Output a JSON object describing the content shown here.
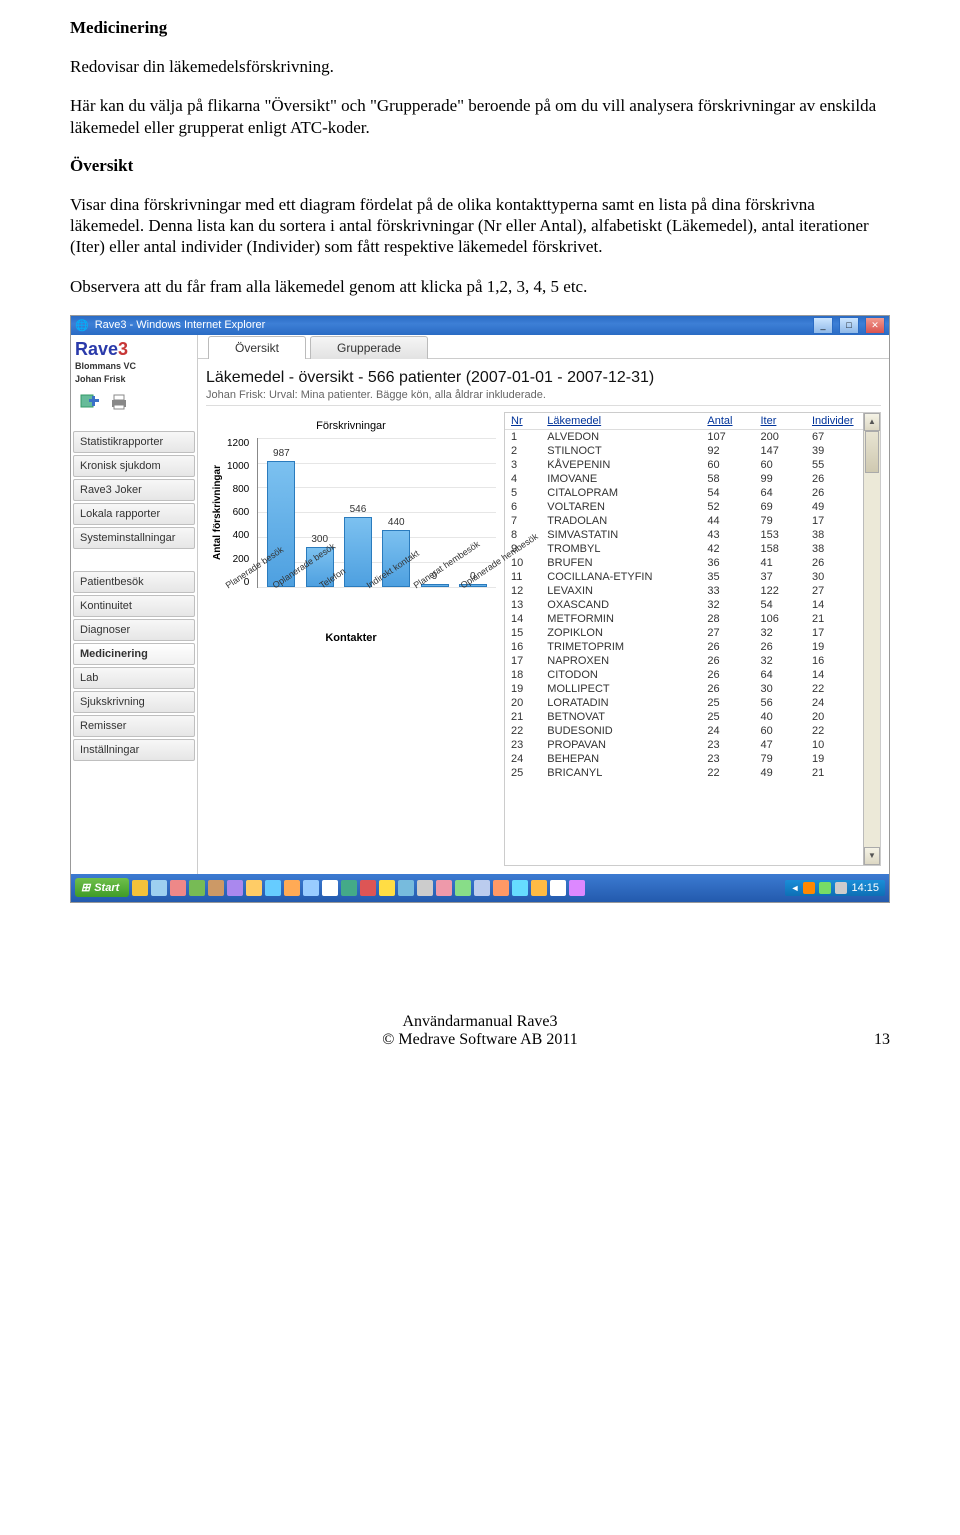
{
  "doc": {
    "h1": "Medicinering",
    "p1": "Redovisar din läkemedelsförskrivning.",
    "p2": "Här kan du välja på flikarna \"Översikt\" och \"Grupperade\" beroende på om du vill analysera förskrivningar av enskilda läkemedel eller grupperat enligt ATC-koder.",
    "h2": "Översikt",
    "p3": "Visar dina förskrivningar med ett diagram fördelat på de olika kontakttyperna samt en lista på dina förskrivna läkemedel. Denna lista kan du sortera i antal förskrivningar (Nr eller Antal), alfabetiskt (Läkemedel), antal iterationer (Iter) eller antal individer (Individer) som fått respektive läkemedel förskrivet.",
    "p4": "Observera att du får fram alla läkemedel genom att klicka på 1,2, 3, 4, 5 etc."
  },
  "window": {
    "title": "Rave3 - Windows Internet Explorer"
  },
  "logo": {
    "main": "Rave",
    "accent": "3"
  },
  "subtitle1": "Blommans VC",
  "subtitle2": "Johan Frisk",
  "menu_top": [
    "Statistikrapporter",
    "Kronisk sjukdom",
    "Rave3 Joker",
    "Lokala rapporter",
    "Systeminstallningar"
  ],
  "menu_bottom": [
    "Patientbesök",
    "Kontinuitet",
    "Diagnoser",
    "Medicinering",
    "Lab",
    "Sjukskrivning",
    "Remisser",
    "Inställningar"
  ],
  "menu_active": "Medicinering",
  "tabs": {
    "t0": "Översikt",
    "t1": "Grupperade"
  },
  "content": {
    "title": "Läkemedel - översikt - 566 patienter (2007-01-01 - 2007-12-31)",
    "subtitle": "Johan Frisk: Urval: Mina patienter. Bägge kön, alla åldrar inkluderade."
  },
  "chart_data": {
    "type": "bar",
    "title": "Förskrivningar",
    "ylabel": "Antal förskrivningar",
    "ylim": [
      0,
      1200
    ],
    "yticks": [
      "1200",
      "1000",
      "800",
      "600",
      "400",
      "200",
      "0"
    ],
    "categories": [
      "Planerade besök",
      "Oplanerade besök",
      "Telefon",
      "Indirekt kontakt",
      "Planerat hembesök",
      "Oplanerade hembesök"
    ],
    "values": [
      987,
      300,
      546,
      440,
      9,
      0
    ],
    "second_title": "Kontakter"
  },
  "table": {
    "headers": {
      "nr": "Nr",
      "name": "Läkemedel",
      "antal": "Antal",
      "iter": "Iter",
      "indiv": "Individer"
    },
    "rows": [
      {
        "nr": 1,
        "name": "ALVEDON",
        "antal": 107,
        "iter": 200,
        "indiv": 67
      },
      {
        "nr": 2,
        "name": "STILNOCT",
        "antal": 92,
        "iter": 147,
        "indiv": 39
      },
      {
        "nr": 3,
        "name": "KÅVEPENIN",
        "antal": 60,
        "iter": 60,
        "indiv": 55
      },
      {
        "nr": 4,
        "name": "IMOVANE",
        "antal": 58,
        "iter": 99,
        "indiv": 26
      },
      {
        "nr": 5,
        "name": "CITALOPRAM",
        "antal": 54,
        "iter": 64,
        "indiv": 26
      },
      {
        "nr": 6,
        "name": "VOLTAREN",
        "antal": 52,
        "iter": 69,
        "indiv": 49
      },
      {
        "nr": 7,
        "name": "TRADOLAN",
        "antal": 44,
        "iter": 79,
        "indiv": 17
      },
      {
        "nr": 8,
        "name": "SIMVASTATIN",
        "antal": 43,
        "iter": 153,
        "indiv": 38
      },
      {
        "nr": 9,
        "name": "TROMBYL",
        "antal": 42,
        "iter": 158,
        "indiv": 38
      },
      {
        "nr": 10,
        "name": "BRUFEN",
        "antal": 36,
        "iter": 41,
        "indiv": 26
      },
      {
        "nr": 11,
        "name": "COCILLANA-ETYFIN",
        "antal": 35,
        "iter": 37,
        "indiv": 30
      },
      {
        "nr": 12,
        "name": "LEVAXIN",
        "antal": 33,
        "iter": 122,
        "indiv": 27
      },
      {
        "nr": 13,
        "name": "OXASCAND",
        "antal": 32,
        "iter": 54,
        "indiv": 14
      },
      {
        "nr": 14,
        "name": "METFORMIN",
        "antal": 28,
        "iter": 106,
        "indiv": 21
      },
      {
        "nr": 15,
        "name": "ZOPIKLON",
        "antal": 27,
        "iter": 32,
        "indiv": 17
      },
      {
        "nr": 16,
        "name": "TRIMETOPRIM",
        "antal": 26,
        "iter": 26,
        "indiv": 19
      },
      {
        "nr": 17,
        "name": "NAPROXEN",
        "antal": 26,
        "iter": 32,
        "indiv": 16
      },
      {
        "nr": 18,
        "name": "CITODON",
        "antal": 26,
        "iter": 64,
        "indiv": 14
      },
      {
        "nr": 19,
        "name": "MOLLIPECT",
        "antal": 26,
        "iter": 30,
        "indiv": 22
      },
      {
        "nr": 20,
        "name": "LORATADIN",
        "antal": 25,
        "iter": 56,
        "indiv": 24
      },
      {
        "nr": 21,
        "name": "BETNOVAT",
        "antal": 25,
        "iter": 40,
        "indiv": 20
      },
      {
        "nr": 22,
        "name": "BUDESONID",
        "antal": 24,
        "iter": 60,
        "indiv": 22
      },
      {
        "nr": 23,
        "name": "PROPAVAN",
        "antal": 23,
        "iter": 47,
        "indiv": 10
      },
      {
        "nr": 24,
        "name": "BEHEPAN",
        "antal": 23,
        "iter": 79,
        "indiv": 19
      },
      {
        "nr": 25,
        "name": "BRICANYL",
        "antal": 22,
        "iter": 49,
        "indiv": 21
      }
    ]
  },
  "taskbar": {
    "start": "Start",
    "clock": "14:15"
  },
  "footer": {
    "line1": "Användarmanual Rave3",
    "line2": "© Medrave Software AB 2011",
    "pagenum": "13"
  }
}
